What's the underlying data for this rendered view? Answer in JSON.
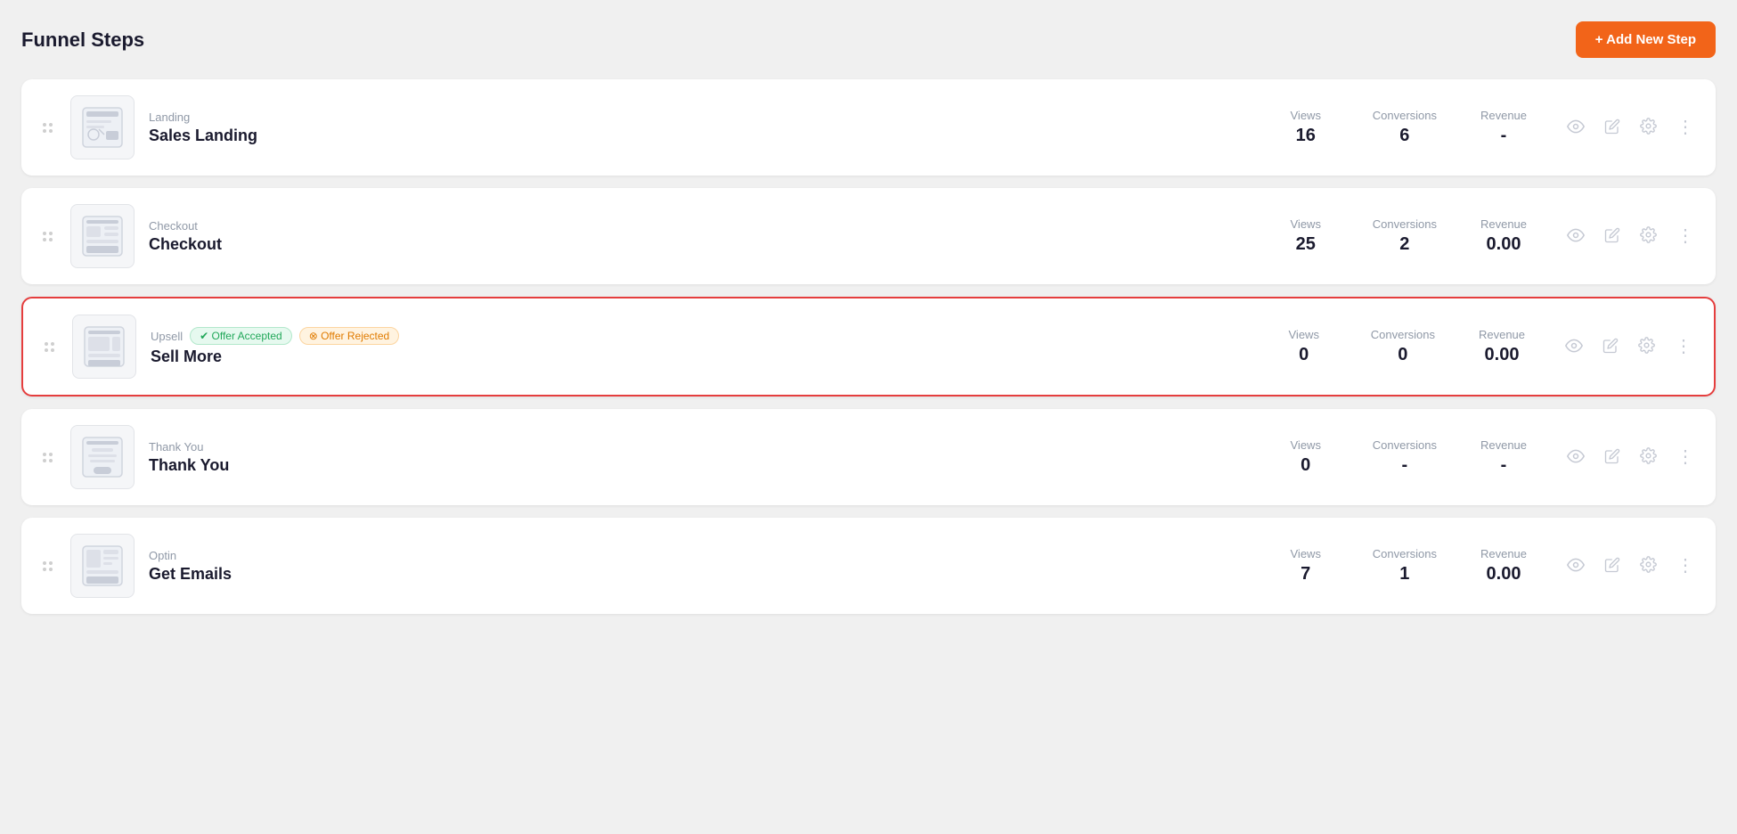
{
  "header": {
    "title": "Funnel Steps",
    "add_button_label": "+ Add New Step"
  },
  "steps": [
    {
      "id": "step-1",
      "type": "Landing",
      "name": "Sales Landing",
      "highlighted": false,
      "badges": [],
      "stats": {
        "views_label": "Views",
        "views_value": "16",
        "conversions_label": "Conversions",
        "conversions_value": "6",
        "revenue_label": "Revenue",
        "revenue_value": "-"
      },
      "thumbnail_type": "landing"
    },
    {
      "id": "step-2",
      "type": "Checkout",
      "name": "Checkout",
      "highlighted": false,
      "badges": [],
      "stats": {
        "views_label": "Views",
        "views_value": "25",
        "conversions_label": "Conversions",
        "conversions_value": "2",
        "revenue_label": "Revenue",
        "revenue_value": "0.00"
      },
      "thumbnail_type": "checkout"
    },
    {
      "id": "step-3",
      "type": "Upsell",
      "name": "Sell More",
      "highlighted": true,
      "badges": [
        {
          "label": "Offer Accepted",
          "type": "accepted"
        },
        {
          "label": "Offer Rejected",
          "type": "rejected"
        }
      ],
      "stats": {
        "views_label": "Views",
        "views_value": "0",
        "conversions_label": "Conversions",
        "conversions_value": "0",
        "revenue_label": "Revenue",
        "revenue_value": "0.00"
      },
      "thumbnail_type": "upsell"
    },
    {
      "id": "step-4",
      "type": "Thank You",
      "name": "Thank You",
      "highlighted": false,
      "badges": [],
      "stats": {
        "views_label": "Views",
        "views_value": "0",
        "conversions_label": "Conversions",
        "conversions_value": "-",
        "revenue_label": "Revenue",
        "revenue_value": "-"
      },
      "thumbnail_type": "thankyou"
    },
    {
      "id": "step-5",
      "type": "Optin",
      "name": "Get Emails",
      "highlighted": false,
      "badges": [],
      "stats": {
        "views_label": "Views",
        "views_value": "7",
        "conversions_label": "Conversions",
        "conversions_value": "1",
        "revenue_label": "Revenue",
        "revenue_value": "0.00"
      },
      "thumbnail_type": "optin"
    }
  ]
}
